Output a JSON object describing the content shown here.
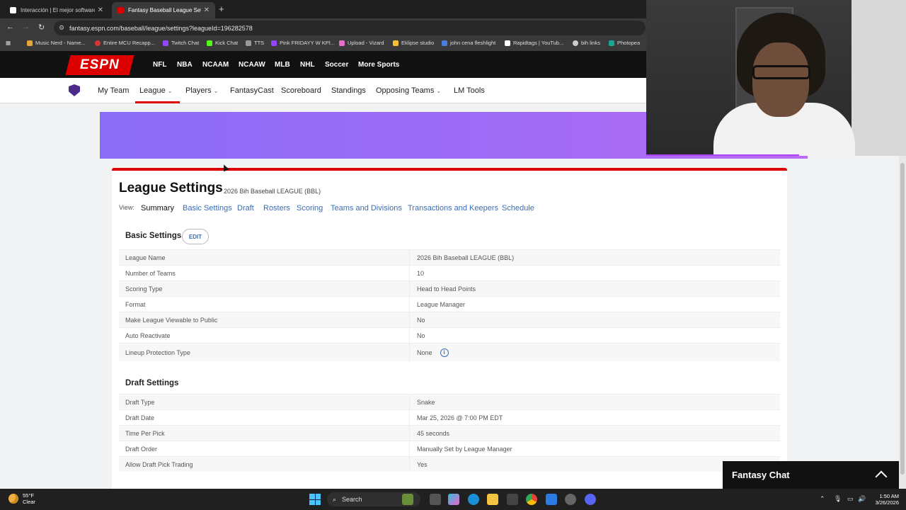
{
  "browser": {
    "tabs": [
      {
        "title": "Interacción | El mejor software d"
      },
      {
        "title": "Fantasy Baseball League Settin"
      }
    ],
    "new_tab_label": "+",
    "url": "fantasy.espn.com/baseball/league/settings?leagueId=196282578",
    "bookmarks": [
      "Music Nerd - Name...",
      "Entire MCU Recapp...",
      "Twitch Chat",
      "Kick Chat",
      "TTS",
      "Pink FRIDAYY W KPI...",
      "Upload - Vizard",
      "Eklipse studio",
      "john cena fleshlight",
      "Rapidtags | YouTub...",
      "bih links",
      "Photopea"
    ]
  },
  "espn": {
    "logo": "ESPN",
    "sports": [
      "NFL",
      "NBA",
      "NCAAM",
      "NCAAW",
      "MLB",
      "NHL",
      "Soccer",
      "More Sports"
    ],
    "subnav": {
      "my_team": "My Team",
      "league": "League",
      "players": "Players",
      "fantasycast": "FantasyCast",
      "scoreboard": "Scoreboard",
      "standings": "Standings",
      "opposing_teams": "Opposing Teams",
      "lm_tools": "LM Tools"
    }
  },
  "settings": {
    "title": "League Settings",
    "subtitle": "2026 Bih Baseball LEAGUE (BBL)",
    "view_label": "View:",
    "views": [
      "Summary",
      "Basic Settings",
      "Draft",
      "Rosters",
      "Scoring",
      "Teams and Divisions",
      "Transactions and Keepers",
      "Schedule"
    ],
    "active_view": "Summary",
    "basic": {
      "heading": "Basic Settings",
      "edit_label": "EDIT",
      "rows": [
        {
          "key": "League Name",
          "value": "2026 Bih Baseball LEAGUE (BBL)"
        },
        {
          "key": "Number of Teams",
          "value": "10"
        },
        {
          "key": "Scoring Type",
          "value": "Head to Head Points"
        },
        {
          "key": "Format",
          "value": "League Manager"
        },
        {
          "key": "Make League Viewable to Public",
          "value": "No"
        },
        {
          "key": "Auto Reactivate",
          "value": "No"
        },
        {
          "key": "Lineup Protection Type",
          "value": "None"
        }
      ]
    },
    "draft": {
      "heading": "Draft Settings",
      "rows": [
        {
          "key": "Draft Type",
          "value": "Snake"
        },
        {
          "key": "Draft Date",
          "value": "Mar 25, 2026 @ 7:00 PM EDT"
        },
        {
          "key": "Time Per Pick",
          "value": "45 seconds"
        },
        {
          "key": "Draft Order",
          "value": "Manually Set by League Manager"
        },
        {
          "key": "Allow Draft Pick Trading",
          "value": "Yes"
        }
      ]
    }
  },
  "chat": {
    "title": "Fantasy Chat"
  },
  "taskbar": {
    "weather_temp": "55°F",
    "weather_cond": "Clear",
    "search_label": "Search",
    "time": "1:50 AM",
    "date": "3/26/2026"
  },
  "colors": {
    "espn_red": "#dd0000",
    "link_blue": "#3a6db5",
    "banner": "#a06cf6"
  }
}
